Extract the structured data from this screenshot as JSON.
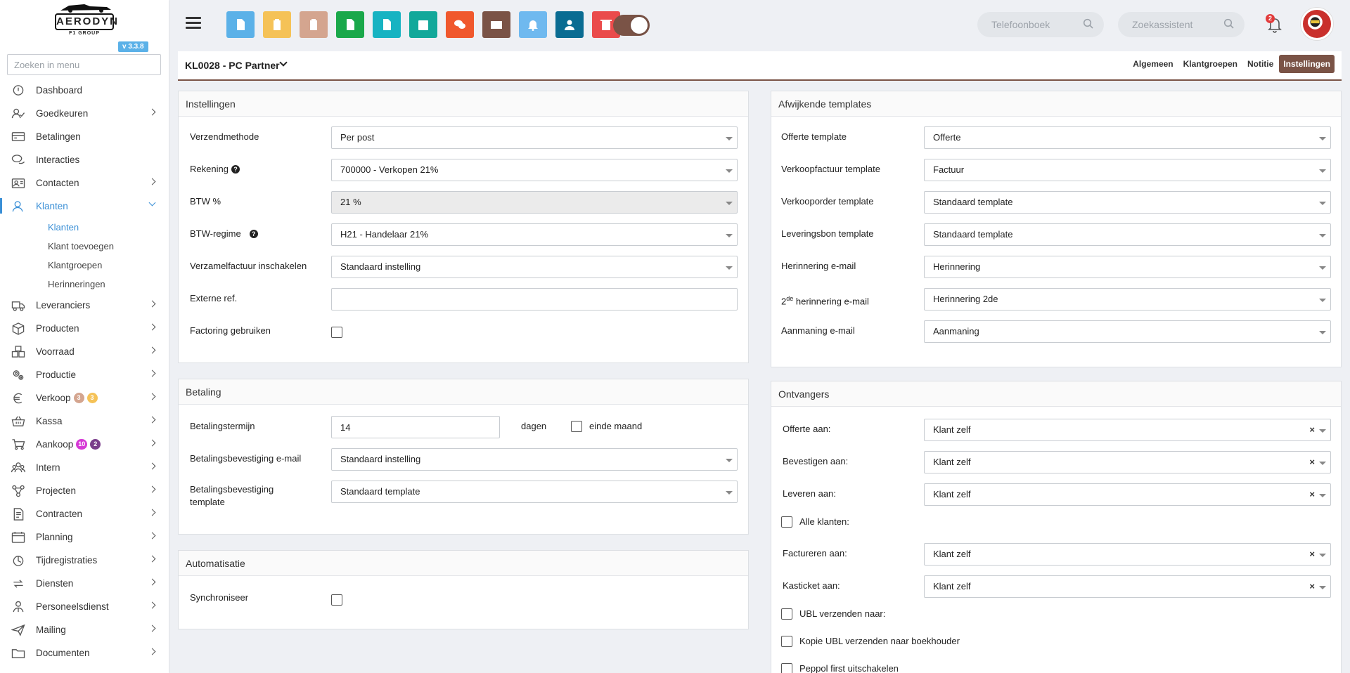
{
  "sidebar": {
    "logo": {
      "word": "AERODYN",
      "sub": "F1 GROUP"
    },
    "version": "v 3.3.8",
    "search_placeholder": "Zoeken in menu",
    "items": [
      {
        "label": "Dashboard",
        "icon": "dashboard-icon"
      },
      {
        "label": "Goedkeuren",
        "icon": "approve-icon"
      },
      {
        "label": "Betalingen",
        "icon": "payments-icon"
      },
      {
        "label": "Interacties",
        "icon": "interactions-icon"
      },
      {
        "label": "Contacten",
        "icon": "contacts-icon"
      },
      {
        "label": "Klanten",
        "icon": "customers-icon"
      },
      {
        "label": "Leveranciers",
        "icon": "truck-icon"
      },
      {
        "label": "Producten",
        "icon": "box-icon"
      },
      {
        "label": "Voorraad",
        "icon": "stock-icon"
      },
      {
        "label": "Productie",
        "icon": "gears-icon"
      },
      {
        "label": "Verkoop",
        "icon": "euro-icon",
        "badges": [
          "3",
          "3"
        ]
      },
      {
        "label": "Kassa",
        "icon": "basket-icon"
      },
      {
        "label": "Aankoop",
        "icon": "cart-icon",
        "badges": [
          "10",
          "2"
        ]
      },
      {
        "label": "Intern",
        "icon": "team-icon"
      },
      {
        "label": "Projecten",
        "icon": "projects-icon"
      },
      {
        "label": "Contracten",
        "icon": "contract-icon"
      },
      {
        "label": "Planning",
        "icon": "calendar-icon"
      },
      {
        "label": "Tijdregistraties",
        "icon": "timer-icon"
      },
      {
        "label": "Diensten",
        "icon": "services-icon"
      },
      {
        "label": "Personeelsdienst",
        "icon": "staff-icon"
      },
      {
        "label": "Mailing",
        "icon": "send-icon"
      },
      {
        "label": "Documenten",
        "icon": "folder-icon"
      }
    ],
    "klanten_sub": [
      "Klanten",
      "Klant toevoegen",
      "Klantgroepen",
      "Herinneringen"
    ]
  },
  "topbar": {
    "buttons": [
      {
        "icon": "document-icon",
        "color": "#5bb1e8"
      },
      {
        "icon": "clipboard-icon",
        "color": "#f5c257"
      },
      {
        "icon": "clipboard-icon",
        "color": "#d4a58f"
      },
      {
        "icon": "spreadsheet-icon",
        "color": "#1aa84a"
      },
      {
        "icon": "file-icon",
        "color": "#17b3c2"
      },
      {
        "icon": "calendar-check-icon",
        "color": "#12a89a"
      },
      {
        "icon": "chat-icon",
        "color": "#f0582d"
      },
      {
        "icon": "envelope-icon",
        "color": "#7a5346"
      },
      {
        "icon": "bell-icon",
        "color": "#6fb9ef"
      },
      {
        "icon": "user-icon",
        "color": "#0a6c92"
      },
      {
        "icon": "trash-icon",
        "color": "#ea4b4b"
      }
    ],
    "phonebook_placeholder": "Telefoonboek",
    "assistant_placeholder": "Zoekassistent",
    "notification_count": "2"
  },
  "page": {
    "title": "KL0028 - PC Partner",
    "tabs": [
      "Algemeen",
      "Klantgroepen",
      "Notitie",
      "Instellingen"
    ],
    "active_tab": "Instellingen"
  },
  "settings": {
    "title": "Instellingen",
    "fields": [
      {
        "label": "Verzendmethode",
        "value": "Per post"
      },
      {
        "label": "Rekening",
        "value": "700000 - Verkopen 21%",
        "help": "?"
      },
      {
        "label": "BTW %",
        "value": "21 %"
      },
      {
        "label": "BTW-regime",
        "value": "H21 - Handelaar 21%",
        "help": "?"
      },
      {
        "label": "Verzamelfactuur inschakelen",
        "value": "Standaard instelling"
      },
      {
        "label": "Externe ref.",
        "value": ""
      },
      {
        "label": "Factoring gebruiken",
        "value": ""
      }
    ]
  },
  "payment": {
    "title": "Betaling",
    "term_label": "Betalingstermijn",
    "term_value": "14",
    "days": "dagen",
    "end_of_month": "einde maand",
    "email_label": "Betalingsbevestiging e-mail",
    "email_value": "Standaard instelling",
    "template_label": "Betalingsbevestiging template",
    "template_value": "Standaard template"
  },
  "automation": {
    "title": "Automatisatie",
    "sync_label": "Synchroniseer"
  },
  "templates": {
    "title": "Afwijkende templates",
    "fields": [
      {
        "label": "Offerte template",
        "value": "Offerte"
      },
      {
        "label": "Verkoopfactuur template",
        "value": "Factuur"
      },
      {
        "label": "Verkooporder template",
        "value": "Standaard template"
      },
      {
        "label": "Leveringsbon template",
        "value": "Standaard template"
      },
      {
        "label": "Herinnering e-mail",
        "value": "Herinnering"
      },
      {
        "label": "herinnering e-mail",
        "value": "Herinnering 2de",
        "prefix": "2",
        "sup": "de"
      },
      {
        "label": "Aanmaning e-mail",
        "value": "Aanmaning"
      }
    ]
  },
  "recipients": {
    "title": "Ontvangers",
    "quote": {
      "label": "Offerte aan:",
      "value": "Klant zelf"
    },
    "confirm": {
      "label": "Bevestigen aan:",
      "value": "Klant zelf"
    },
    "deliver": {
      "label": "Leveren aan:",
      "value": "Klant zelf"
    },
    "all_customers": "Alle klanten:",
    "invoice": {
      "label": "Factureren aan:",
      "value": "Klant zelf"
    },
    "receipt": {
      "label": "Kasticket aan:",
      "value": "Klant zelf"
    },
    "ubl": "UBL verzenden naar:",
    "ubl_copy": "Kopie UBL verzenden naar boekhouder",
    "peppol": "Peppol first uitschakelen",
    "clear": "×"
  },
  "colors": {
    "accent": "#7a5346",
    "link": "#3a8fd6"
  }
}
